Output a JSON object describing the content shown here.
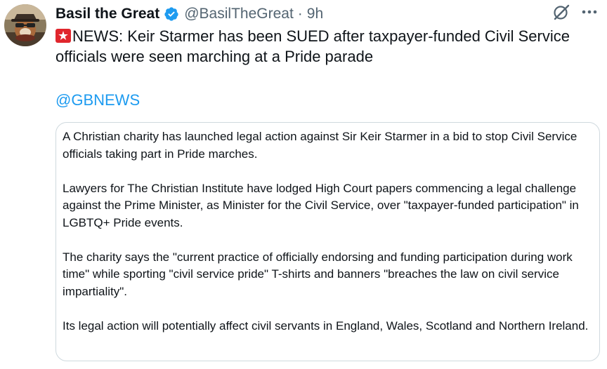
{
  "tweet": {
    "display_name": "Basil the Great",
    "handle": "@BasilTheGreat",
    "separator": "·",
    "time": "9h",
    "text": "NEWS: Keir Starmer has been SUED after taxpayer-funded Civil Service officials were seen marching at a Pride parade",
    "mention": "@GBNEWS",
    "icons": {
      "avatar": "avatar",
      "verified": "verified-badge-icon",
      "grok": "grok-icon",
      "more": "more-icon",
      "alarm": "rotating-light-icon"
    },
    "colors": {
      "verified": "#1d9bf0",
      "link": "#1d9bf0",
      "secondary_text": "#536471",
      "alarm": "#e0262d"
    }
  },
  "card": {
    "paragraphs": [
      "A Christian charity has launched legal action against Sir Keir Starmer in a bid to stop Civil Service officials taking part in Pride marches.",
      "Lawyers for The Christian Institute have lodged High Court papers commencing a legal challenge against the Prime Minister, as Minister for the Civil Service, over \"taxpayer-funded participation\" in LGBTQ+ Pride events.",
      "The charity says the \"current practice of officially endorsing and funding participation during work time\" while sporting \"civil service pride\" T-shirts and banners \"breaches the law on civil service impartiality\".",
      "Its legal action will potentially affect civil servants in England, Wales, Scotland and Northern Ireland."
    ]
  }
}
